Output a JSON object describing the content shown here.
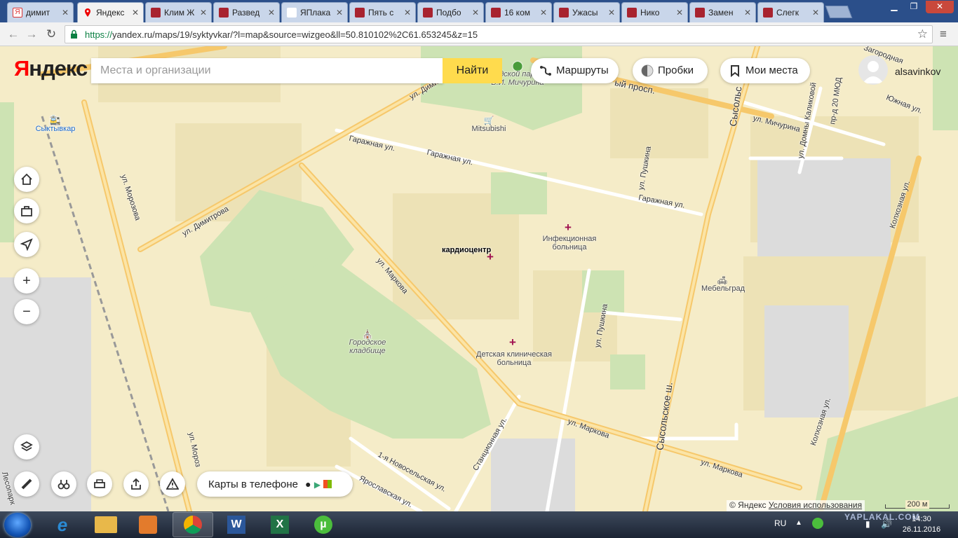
{
  "browser": {
    "tabs": [
      {
        "label": "димит",
        "icon": "yandex-search-icon"
      },
      {
        "label": "Яндекс",
        "icon": "yandex-maps-pin-icon",
        "active": true
      },
      {
        "label": "Клим Ж",
        "icon": "yaplakal-icon"
      },
      {
        "label": "Развед",
        "icon": "yaplakal-icon"
      },
      {
        "label": "ЯПлака",
        "icon": "yaplakal-icon"
      },
      {
        "label": "Пять с",
        "icon": "yaplakal-icon"
      },
      {
        "label": "Подбо",
        "icon": "yaplakal-icon"
      },
      {
        "label": "16 ком",
        "icon": "yaplakal-icon"
      },
      {
        "label": "Ужасы",
        "icon": "yaplakal-icon"
      },
      {
        "label": "Нико",
        "icon": "yaplakal-icon"
      },
      {
        "label": "Замен",
        "icon": "yaplakal-icon"
      },
      {
        "label": "Слегк",
        "icon": "yaplakal-icon"
      }
    ],
    "url_scheme": "https://",
    "url_rest": "yandex.ru/maps/19/syktyvkar/?l=map&source=wizgeo&ll=50.810102%2C61.653245&z=15"
  },
  "yandex": {
    "logo_ya": "Я",
    "logo_rest": "ндекс",
    "search_placeholder": "Места и организации",
    "search_button": "Найти",
    "routes": "Маршруты",
    "traffic": "Пробки",
    "my_places": "Мои места",
    "username": "alsavinkov",
    "apps_promo": "Карты в телефоне",
    "copyright": "© Яндекс",
    "terms": "Условия использования",
    "scale": "200 м"
  },
  "map_labels": {
    "station": "Сыктывкар",
    "park": "Городской парк им. В.И. Мичурина",
    "mitsubishi": "Mitsubishi",
    "cardiocenter": "кардиоцентр",
    "infection_hospital": "Инфекционная больница",
    "childrens_hospital": "Детская клиническая больница",
    "cemetery": "Городское кладбище",
    "mebelgrad": "Мебельград",
    "street_morozova": "ул. Морозова",
    "street_moroz2": "ул. Мороз",
    "street_dimitrova": "ул. Димитрова",
    "street_dimi2": "ул. Дими",
    "street_garazhnaya": "Гаражная ул.",
    "street_markova": "ул. Маркова",
    "street_pushkina": "ул. Пушкина",
    "street_sysolskoe": "Сысольское ш.",
    "street_michurina": "ул. Мичурина",
    "street_kolkhoznaya": "Колхозная ул.",
    "street_stantsionnaya": "Станционная ул.",
    "street_novoselskaya": "1-я Новосельская ул.",
    "street_yaroslavskaya": "Ярославская ул.",
    "street_yuzhnaya": "Южная ул.",
    "street_zagorodnaya": "Загородная",
    "street_domny": "ул. Домны Каликовой",
    "street_20mod": "пр-д 20 МЮД",
    "street_prosp": "ый просп.",
    "street_lesopark": "Лесопарк",
    "street_sysol_top": "Сысольс"
  },
  "taskbar": {
    "lang": "RU",
    "time": "14:30",
    "date": "26.11.2016",
    "watermark": "YAPLAKAL.COM"
  },
  "colors": {
    "map_bg": "#f5ecc8",
    "park": "#cde3b3",
    "road_major": "#f6c86b",
    "accent_yellow": "#ffdb4d",
    "poi_medical": "#a01050"
  }
}
